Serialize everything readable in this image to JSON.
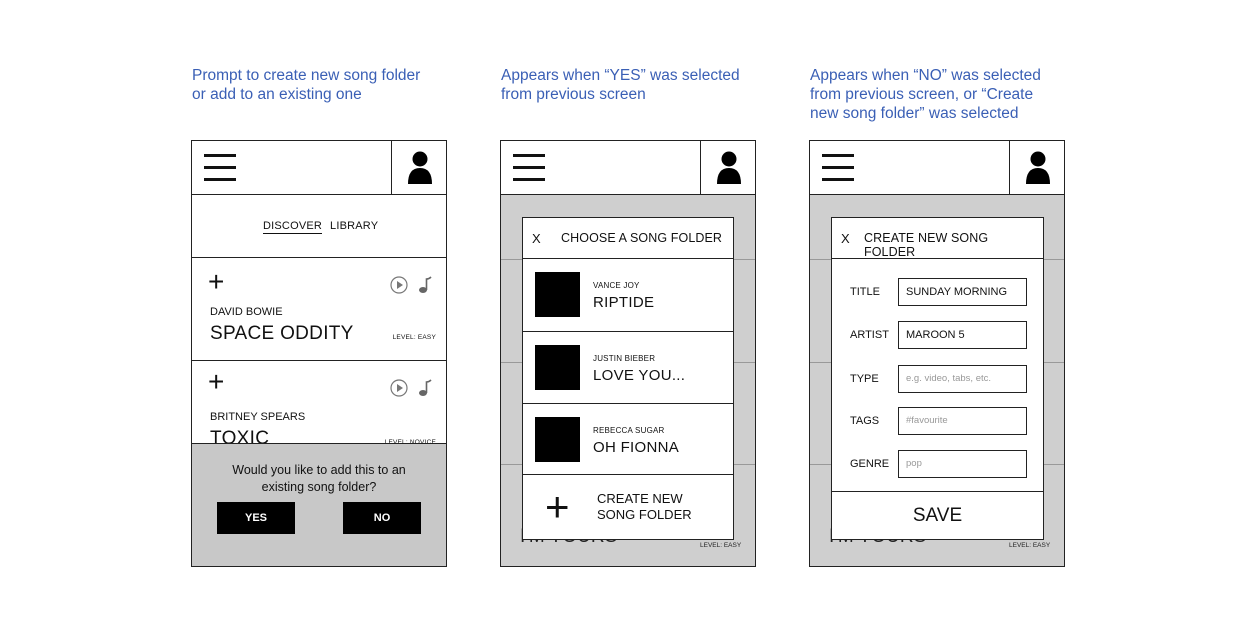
{
  "captions": [
    [
      "Prompt to create new song folder",
      "or add to an existing one"
    ],
    [
      "Appears when “YES” was selected",
      "from previous screen"
    ],
    [
      "Appears when “NO” was selected",
      "from previous screen, or “Create",
      "new song folder” was selected"
    ]
  ],
  "header": {
    "menu_icon": "hamburger-icon",
    "user_icon": "user-icon"
  },
  "screen1": {
    "tabs": [
      "DISCOVER",
      "LIBRARY"
    ],
    "songs": [
      {
        "add": "+",
        "artist": "DAVID BOWIE",
        "title": "SPACE ODDITY",
        "level": "LEVEL: EASY"
      },
      {
        "add": "+",
        "artist": "BRITNEY SPEARS",
        "title": "TOXIC",
        "level": "LEVEL: NOVICE"
      }
    ],
    "prompt": {
      "question": "Would you like to add this to an existing song folder?",
      "yes": "YES",
      "no": "NO"
    }
  },
  "screen2": {
    "close": "X",
    "title": "CHOOSE A SONG FOLDER",
    "folders": [
      {
        "artist": "VANCE JOY",
        "song": "RIPTIDE"
      },
      {
        "artist": "JUSTIN BIEBER",
        "song": "LOVE YOU..."
      },
      {
        "artist": "REBECCA SUGAR",
        "song": "OH FIONNA"
      }
    ],
    "create_plus": "+",
    "create_line1": "CREATE NEW",
    "create_line2": "SONG FOLDER",
    "bg_song": "I'M YOURS",
    "bg_level": "LEVEL: EASY"
  },
  "screen3": {
    "close": "X",
    "title": "CREATE NEW SONG FOLDER",
    "fields": [
      {
        "label": "TITLE",
        "value": "SUNDAY MORNING",
        "placeholder": ""
      },
      {
        "label": "ARTIST",
        "value": "MAROON 5",
        "placeholder": ""
      },
      {
        "label": "TYPE",
        "value": "",
        "placeholder": "e.g. video, tabs, etc."
      },
      {
        "label": "TAGS",
        "value": "",
        "placeholder": "#favourite"
      },
      {
        "label": "GENRE",
        "value": "",
        "placeholder": "pop"
      }
    ],
    "save": "SAVE",
    "bg_song": "I'M YOURS",
    "bg_level": "LEVEL: EASY"
  }
}
